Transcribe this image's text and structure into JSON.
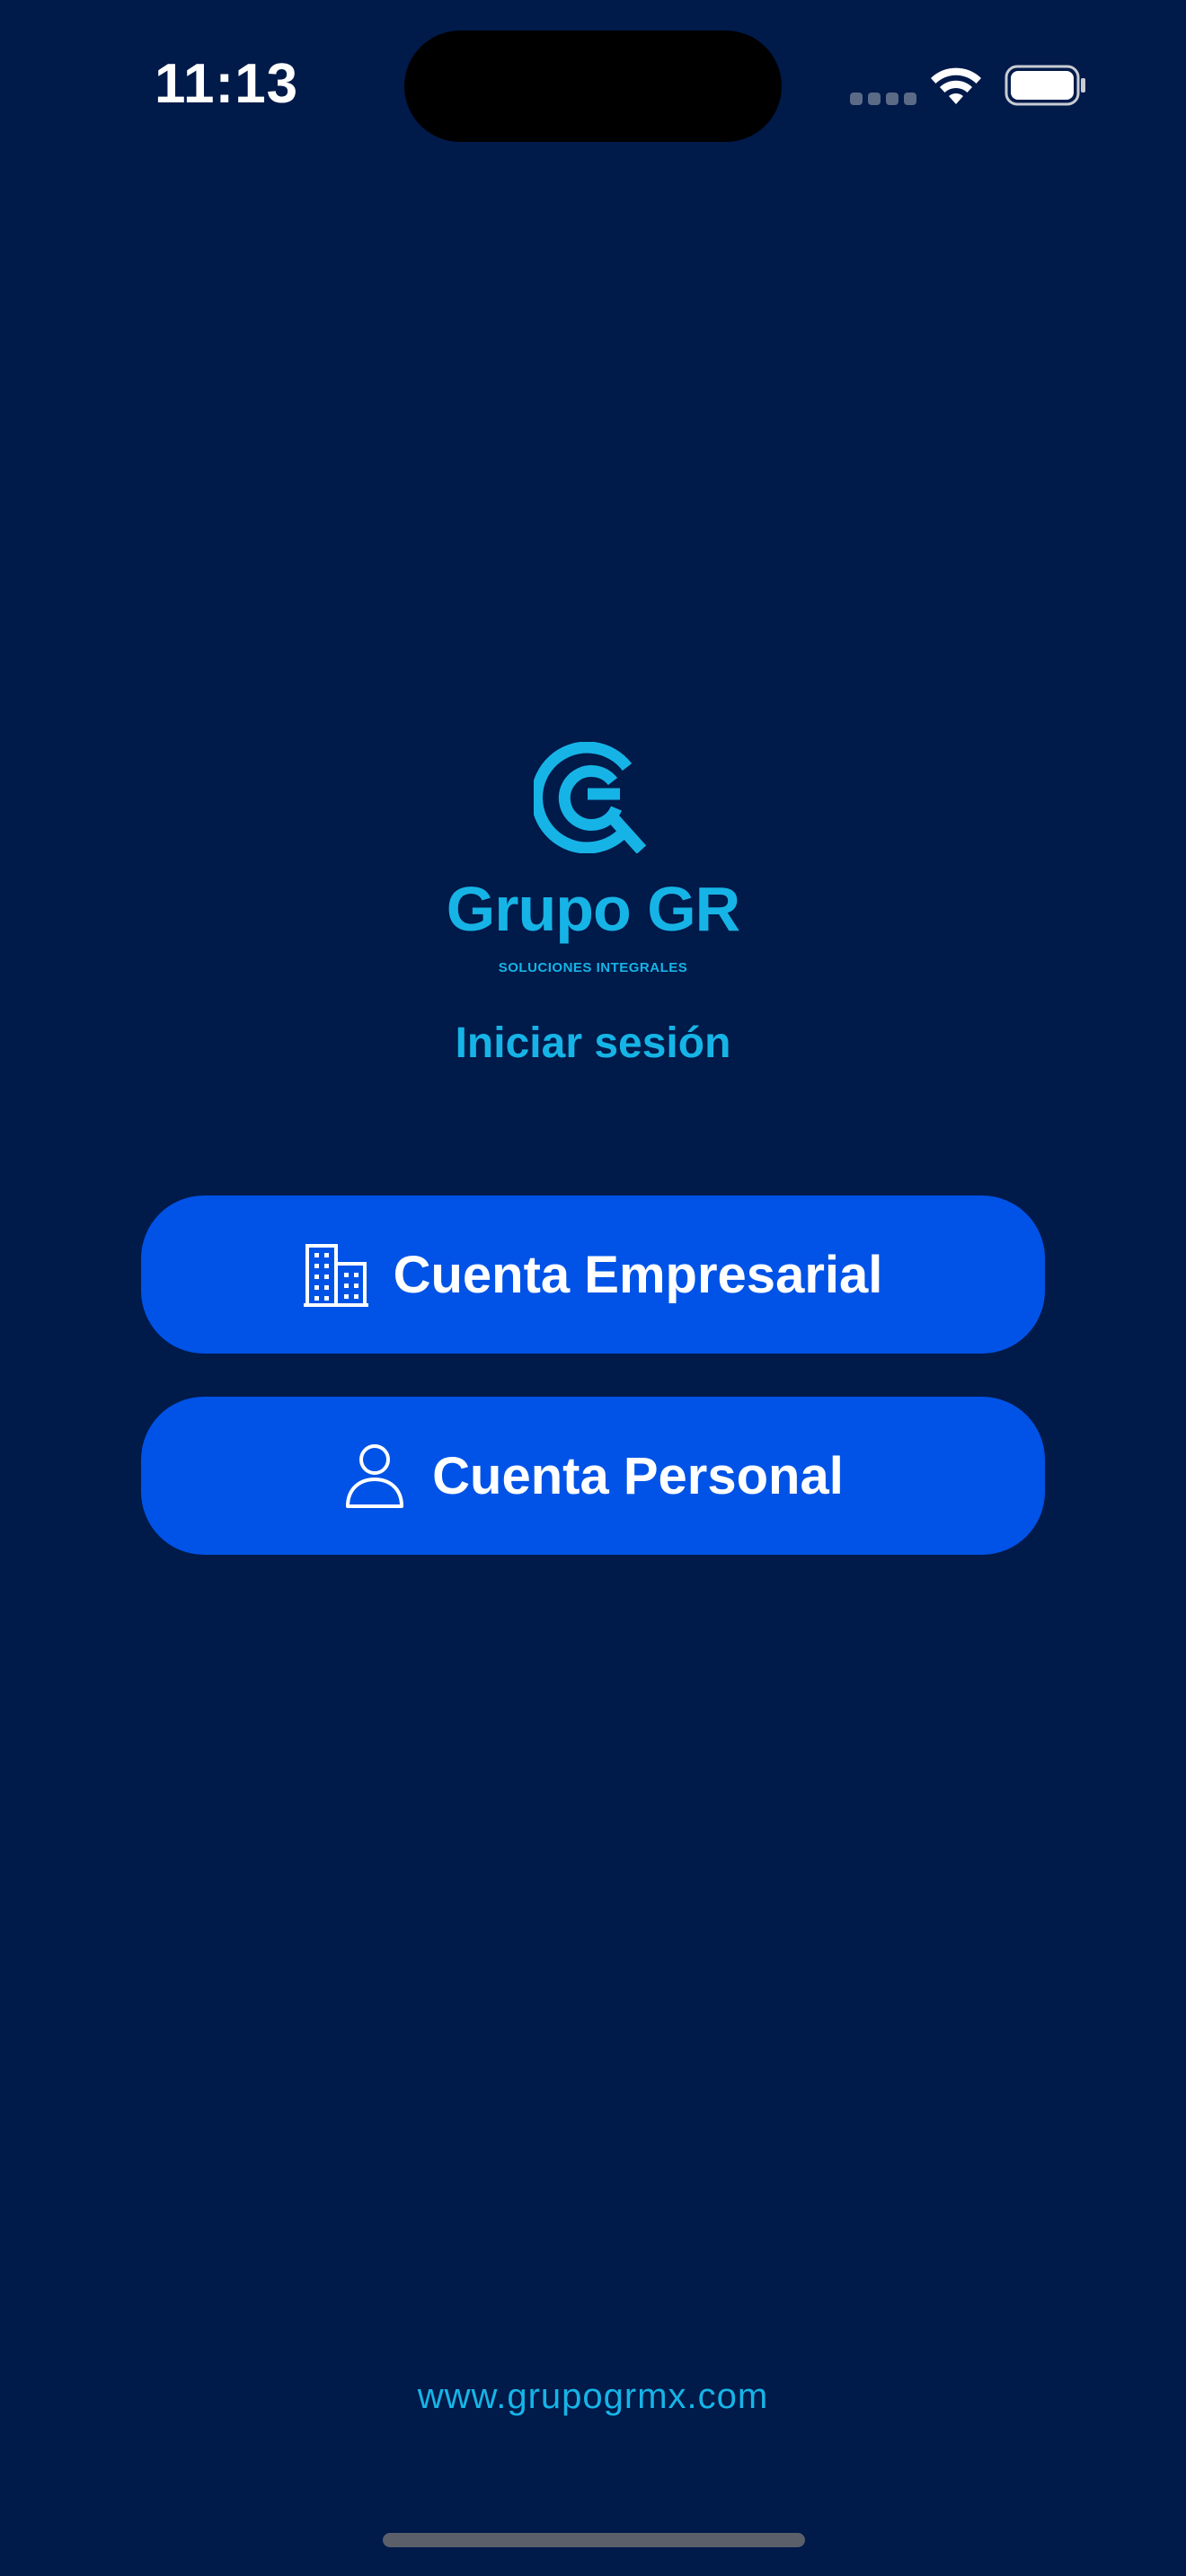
{
  "status_bar": {
    "time": "11:13"
  },
  "brand": {
    "name": "Grupo GR",
    "tagline": "SOLUCIONES INTEGRALES",
    "logo_icon": "grupo-gr-logo",
    "accent_color": "#16b4e6"
  },
  "login": {
    "title": "Iniciar sesión"
  },
  "buttons": {
    "business_label": "Cuenta Empresarial",
    "business_icon": "building-icon",
    "personal_label": "Cuenta Personal",
    "personal_icon": "person-icon",
    "color": "#0053e6"
  },
  "footer": {
    "website": "www.grupogrmx.com"
  },
  "colors": {
    "background": "#001a4a"
  }
}
